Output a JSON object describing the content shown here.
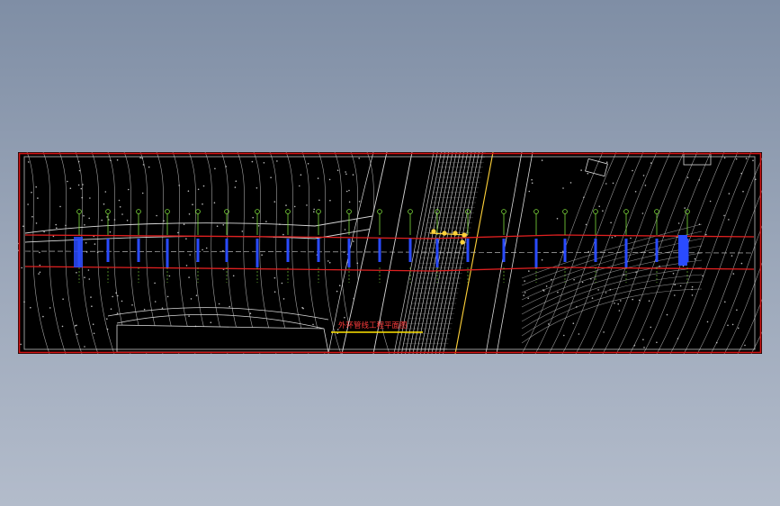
{
  "drawing": {
    "title_text": "外环管线工程平面图",
    "colors": {
      "frame": "#d21414",
      "background": "#000000",
      "linework": "#d8d8d8",
      "road_band": "#e02020",
      "markers": "#2a4bff",
      "labels": "#7fdc3c",
      "highlight": "#ffd23a",
      "title": "#ff3b3b",
      "title_underline": "#ffe400"
    }
  }
}
